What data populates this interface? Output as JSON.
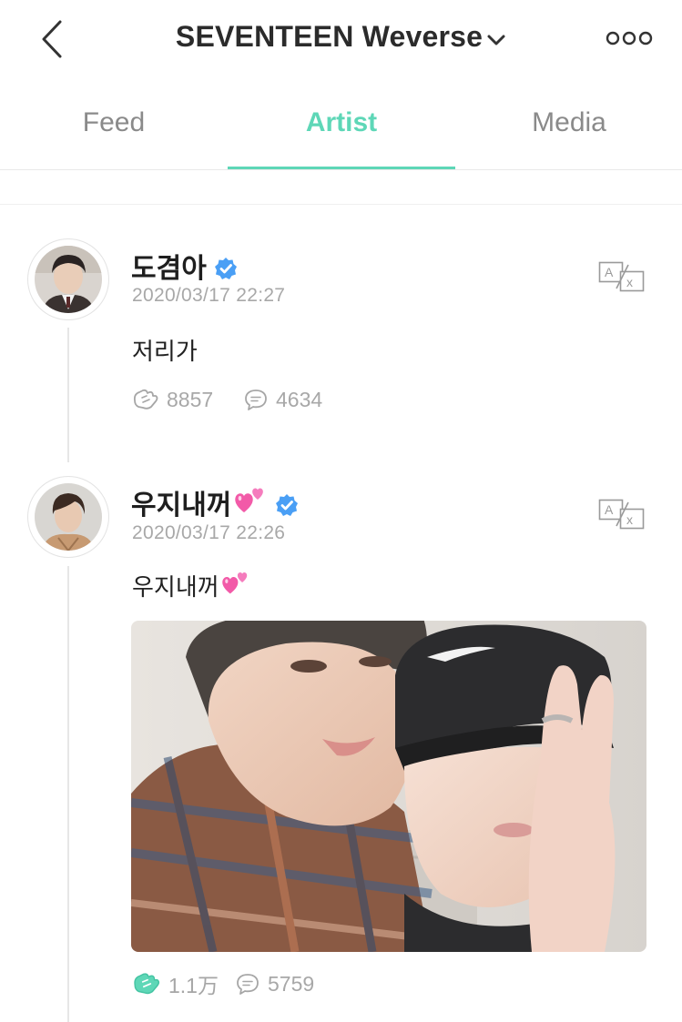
{
  "header": {
    "title": "SEVENTEEN Weverse",
    "back_icon": "chevron-left-icon",
    "dropdown_icon": "chevron-down-icon",
    "more_icon": "more-horizontal-icon"
  },
  "tabs": [
    {
      "label": "Feed",
      "active": false
    },
    {
      "label": "Artist",
      "active": true
    },
    {
      "label": "Media",
      "active": false
    }
  ],
  "colors": {
    "accent": "#5ed7b7",
    "verified": "#4a9ff5",
    "muted_text": "#a8a8a8",
    "heart_pink": "#f25aa8"
  },
  "posts": [
    {
      "author": "도겸아",
      "verified": true,
      "timestamp": "2020/03/17 22:27",
      "text": "저리가",
      "cheers": "8857",
      "comments": "4634",
      "cheered": false,
      "has_photo": false
    },
    {
      "author": "우지내꺼",
      "author_emoji": "two-hearts-emoji",
      "verified": true,
      "timestamp": "2020/03/17 22:26",
      "text": "우지내꺼",
      "text_emoji": "two-hearts-emoji",
      "cheers": "1.1万",
      "comments": "5759",
      "cheered": true,
      "has_photo": true,
      "photo_description_icon": "photo"
    }
  ]
}
